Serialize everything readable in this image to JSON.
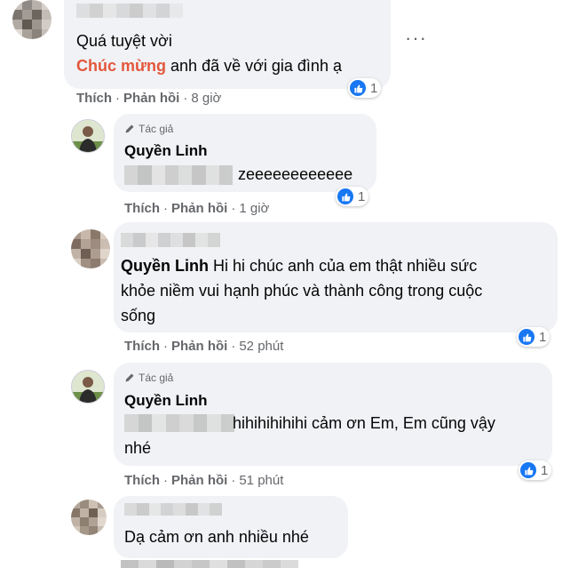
{
  "comments": [
    {
      "text_line1": "Quá tuyệt vời",
      "highlight": "Chúc mừng",
      "text_line2_rest": " anh đã về với gia đình ạ",
      "actions": {
        "like": "Thích",
        "reply": "Phản hồi",
        "time": "8 giờ"
      },
      "reaction_count": "1"
    },
    {
      "author_tag": "Tác giả",
      "name": "Quyền Linh",
      "text": "zeeeeeeeeeeee",
      "actions": {
        "like": "Thích",
        "reply": "Phản hồi",
        "time": "1 giờ"
      },
      "reaction_count": "1"
    },
    {
      "name": "Quyền Linh",
      "text_line1_rest": " Hi hi chúc anh của em thật nhiều sức",
      "text_line2": "khỏe niềm vui hạnh phúc và thành công trong cuộc",
      "text_line3": "sống",
      "actions": {
        "like": "Thích",
        "reply": "Phản hồi",
        "time": "52 phút"
      },
      "reaction_count": "1"
    },
    {
      "author_tag": "Tác giả",
      "name": "Quyền Linh",
      "text_line1_rest": " hihihihihihi cảm ơn Em, Em cũng vậy",
      "text_line2": "nhé",
      "actions": {
        "like": "Thích",
        "reply": "Phản hồi",
        "time": "51 phút"
      },
      "reaction_count": "1"
    },
    {
      "text": "Dạ cảm ơn anh nhiều nhé"
    }
  ],
  "icons": {
    "like": "like-icon",
    "pencil": "pencil-icon",
    "more": "more-options-icon"
  },
  "colors": {
    "highlight": "#e4573d",
    "bubble": "#f0f2f5",
    "like_blue": "#1877f2",
    "meta_gray": "#65676b"
  }
}
